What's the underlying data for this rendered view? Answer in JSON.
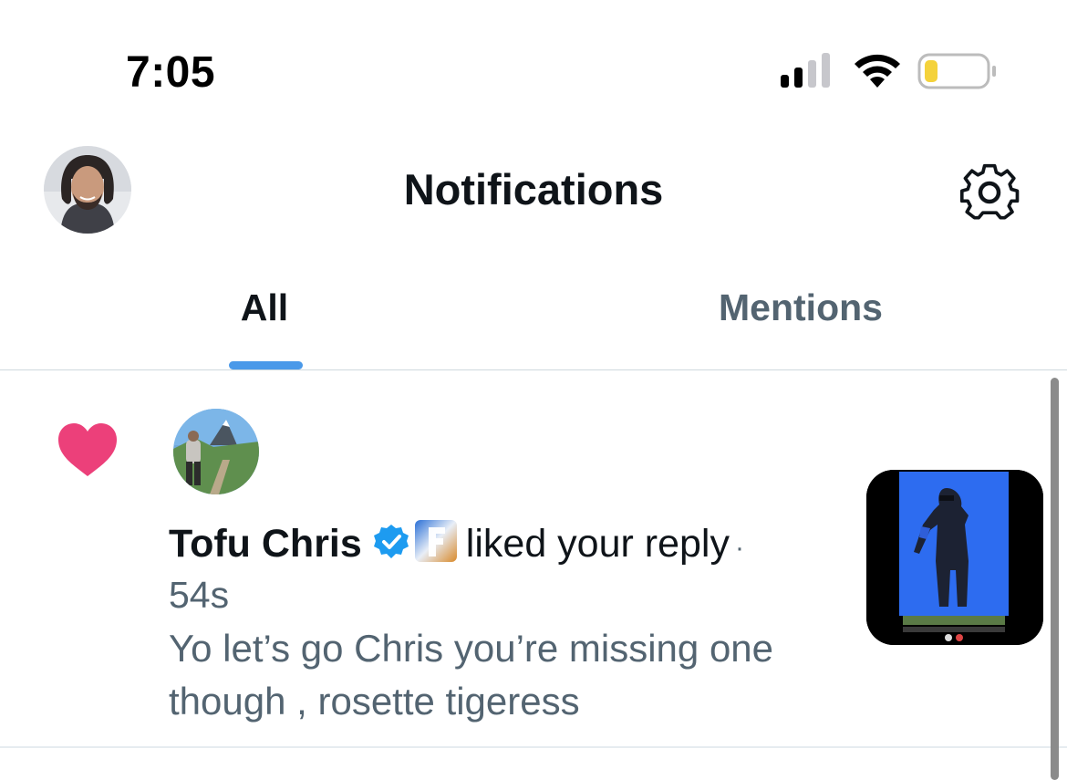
{
  "status_bar": {
    "time": "7:05"
  },
  "header": {
    "title": "Notifications"
  },
  "tabs": [
    {
      "label": "All",
      "active": true
    },
    {
      "label": "Mentions",
      "active": false
    }
  ],
  "colors": {
    "accent": "#4a99e9",
    "heart": "#ec407a",
    "primary_text": "#0f1419",
    "secondary_text": "#536471"
  },
  "notification": {
    "type_icon": "heart-icon",
    "actor_name": "Tofu Chris",
    "action_text": "liked your reply",
    "separator": "·",
    "time": "54s",
    "reply_text": "Yo let’s go Chris you’re missing one though , rosette tigeress"
  }
}
